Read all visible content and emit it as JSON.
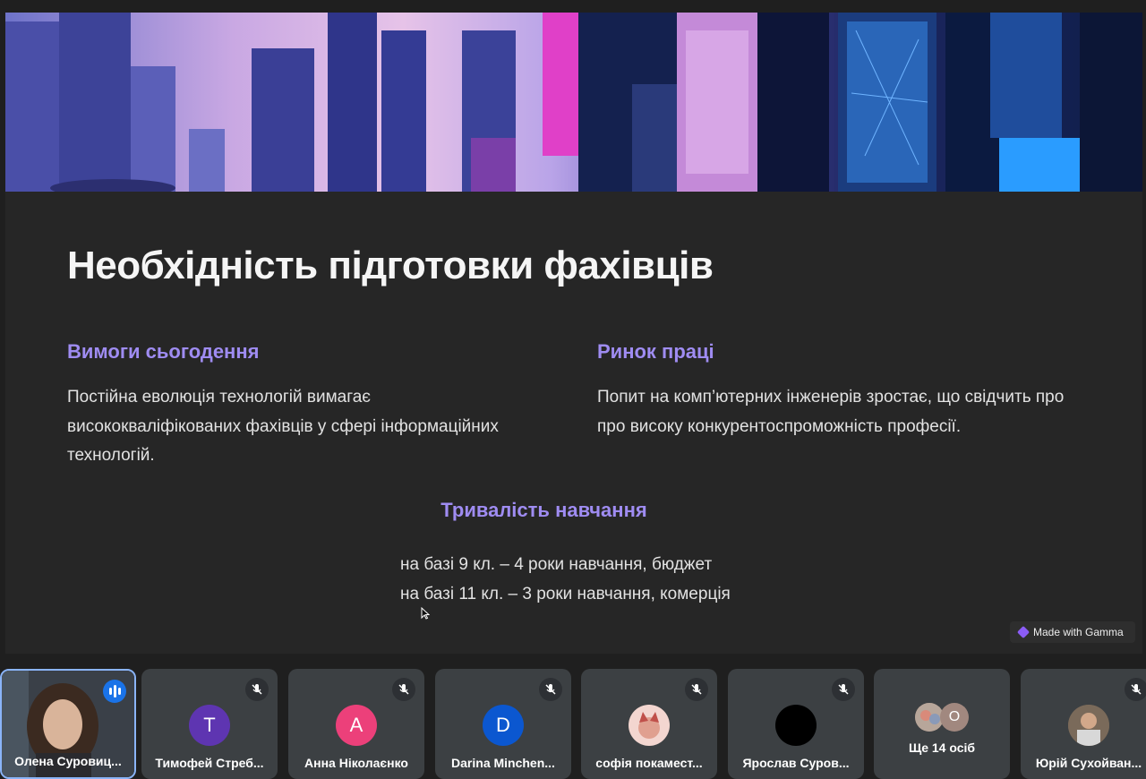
{
  "slide": {
    "title": "Необхідність підготовки фахівців",
    "sections": [
      {
        "heading": "Вимоги сьогодення",
        "lines": [
          "Постійна еволюція технологій вимагає",
          "висококваліфікованих фахівців у сфері інформаційних",
          "технологій."
        ]
      },
      {
        "heading": "Ринок праці",
        "lines": [
          "Попит на комп’ютерних інженерів зростає, що свідчить про",
          "про високу конкурентоспроможність професії."
        ]
      }
    ],
    "duration": {
      "heading": "Тривалість навчання",
      "lines": [
        "на базі 9 кл. – 4 роки навчання, бюджет",
        "на базі 11 кл. – 3 роки навчання, комерція"
      ]
    },
    "badge": "Made with Gamma"
  },
  "participants": [
    {
      "name": "Олена Суровиц...",
      "type": "video",
      "status": "speaking"
    },
    {
      "name": "Тимофей Стреб...",
      "initial": "Т",
      "color": "#5e35b1",
      "status": "muted"
    },
    {
      "name": "Анна Ніколаєнко",
      "initial": "А",
      "color": "#ec407a",
      "status": "muted"
    },
    {
      "name": "Darina Minchen...",
      "initial": "D",
      "color": "#0b57d0",
      "status": "muted"
    },
    {
      "name": "софія покамест...",
      "type": "photo",
      "status": "muted"
    },
    {
      "name": "Ярослав Суров...",
      "type": "photo-black",
      "status": "muted"
    },
    {
      "name": "Ще 14 осіб",
      "type": "more",
      "mini_initial": "О",
      "mini_color": "#a1887f"
    },
    {
      "name": "Юрій Сухойван...",
      "type": "photo",
      "status": "muted"
    }
  ],
  "colors": {
    "accent": "#9f8cf2",
    "speaking": "#1a73e8",
    "tile": "#3c4043"
  }
}
